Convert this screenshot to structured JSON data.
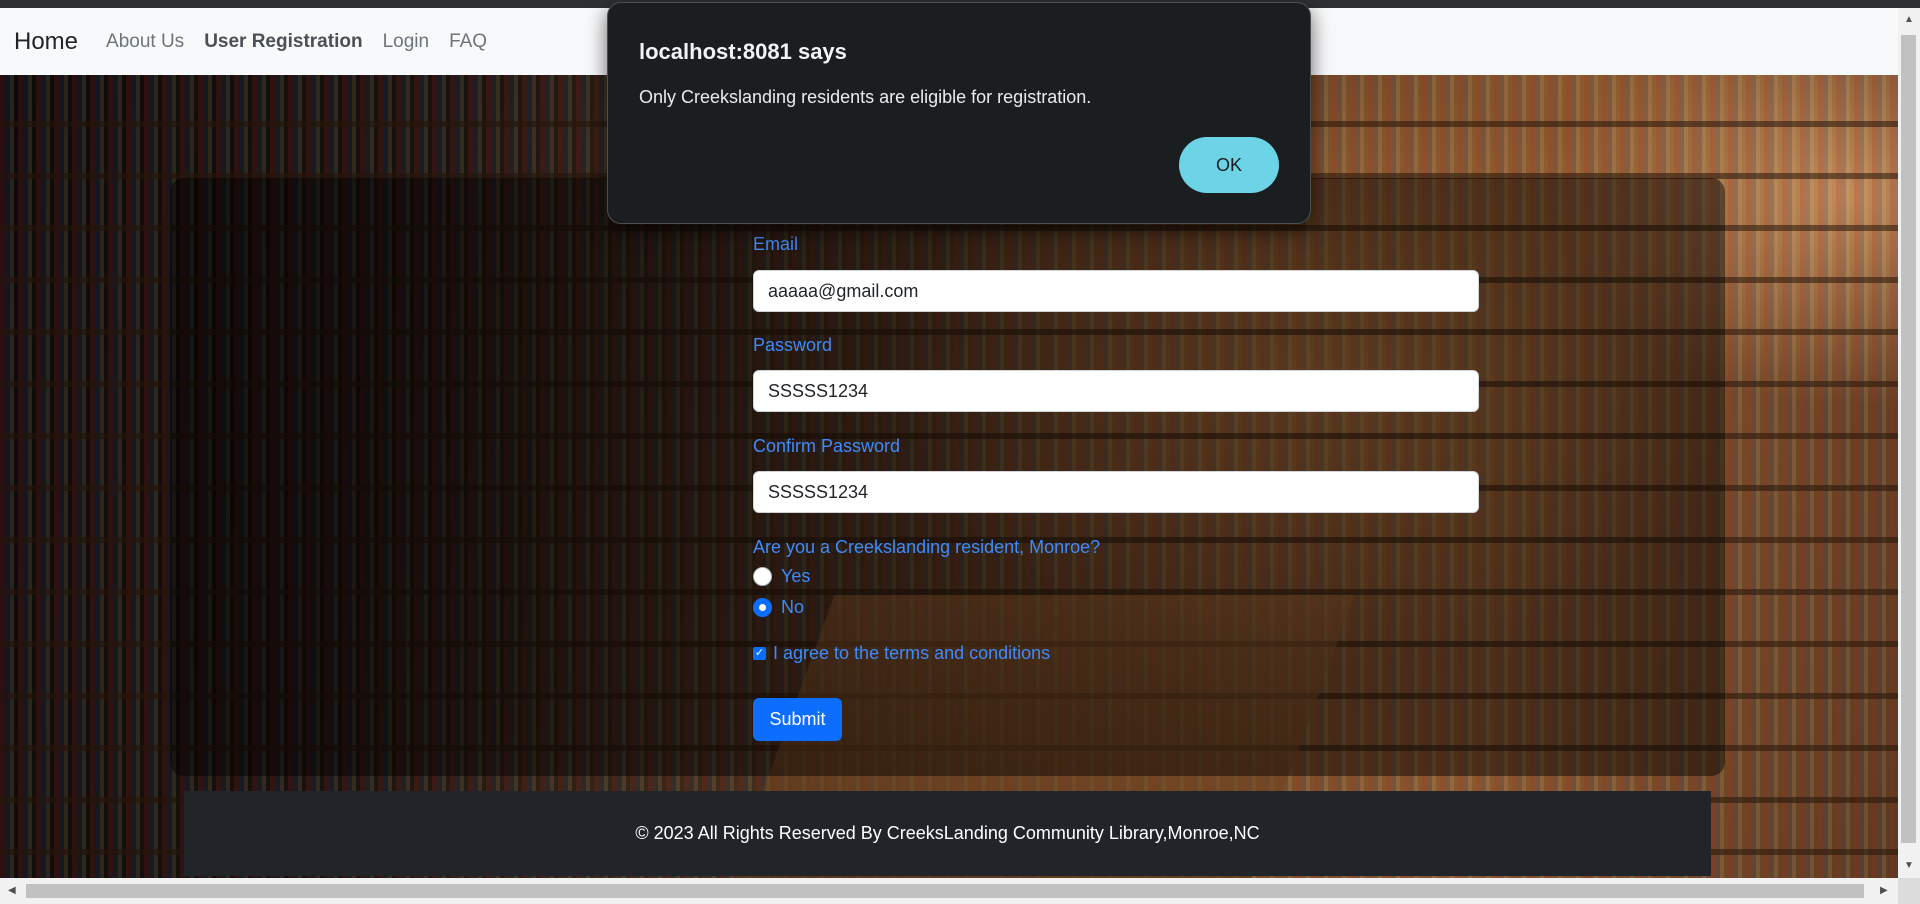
{
  "nav": {
    "brand": "Home",
    "links": [
      "About Us",
      "User Registration",
      "Login",
      "FAQ"
    ],
    "active": "User Registration"
  },
  "form": {
    "email_label": "Email",
    "email_value": "aaaaa@gmail.com",
    "password_label": "Password",
    "password_value": "SSSSS1234",
    "confirm_label": "Confirm Password",
    "confirm_value": "SSSSS1234",
    "resident_question": "Are you a Creekslanding resident, Monroe?",
    "options": [
      "Yes",
      "No"
    ],
    "selected_option": "No",
    "terms_label": "I agree to the terms and conditions",
    "terms_checked": true,
    "submit_label": "Submit"
  },
  "footer": {
    "text": "© 2023 All Rights Reserved By CreeksLanding Community Library,Monroe,NC"
  },
  "dialog": {
    "title": "localhost:8081 says",
    "message": "Only Creekslanding residents are eligible for registration.",
    "ok_label": "OK"
  },
  "colors": {
    "navbar_bg": "#f8f9fa",
    "label_blue": "#3d8bfd",
    "button_blue": "#0d6efd",
    "footer_bg": "#212529",
    "dialog_bg": "#1b1e21",
    "dialog_button": "#6dd3e6"
  }
}
